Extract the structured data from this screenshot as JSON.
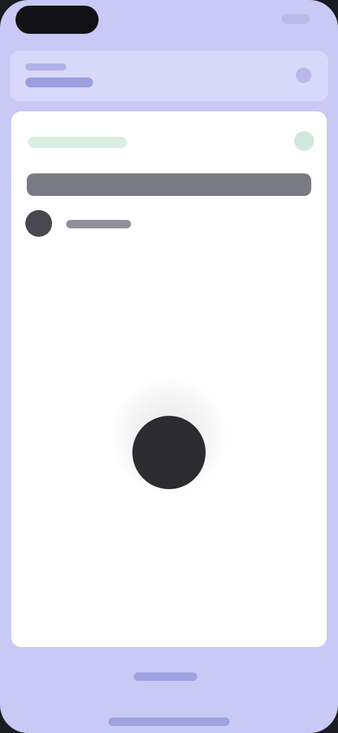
{
  "screen": {
    "background": "#c8c9f4",
    "status_bar": {
      "time": "",
      "indicators": ""
    }
  },
  "header": {
    "label": "",
    "title": "",
    "icon": "chevron-down-icon"
  },
  "card": {
    "badge": "",
    "title": "",
    "author": "",
    "icon": "close-icon"
  },
  "player": {
    "play_icon": "play-icon",
    "button_color": "#2b2b30"
  },
  "bottom": {
    "pill_label": "",
    "home_indicator": "home-indicator"
  }
}
